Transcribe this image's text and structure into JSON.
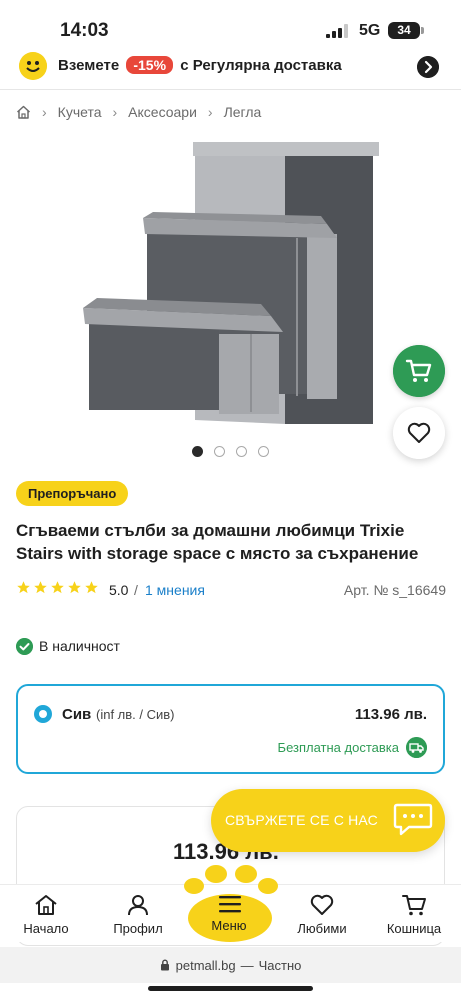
{
  "status": {
    "time": "14:03",
    "network": "5G",
    "battery": "34"
  },
  "promo": {
    "before": "Вземете",
    "badge": "-15%",
    "after": "с Регулярна доставка",
    "icon": "smiley-icon"
  },
  "breadcrumb": {
    "items": [
      "Кучета",
      "Аксесоари",
      "Легла"
    ]
  },
  "gallery": {
    "total": 4,
    "active": 1
  },
  "product": {
    "badge": "Препоръчано",
    "title": "Сгъваеми стълби за домашни любимци Trixie Stairs with storage space с място за съхранение",
    "rating": 5.0,
    "rating_text": "5.0",
    "rating_sep": "/",
    "reviews": "1 мнения",
    "sku": "Арт. № s_16649",
    "stock": "В наличност"
  },
  "variant": {
    "name": "Сив",
    "meta": "(inf лв. / Сив)",
    "price": "113.96 лв.",
    "shipping": "Безплатна доставка"
  },
  "price_card": {
    "price": "113.96 лв."
  },
  "contact": {
    "label": "СВЪРЖЕТЕ СЕ С НАС"
  },
  "nav": {
    "home": "Начало",
    "profile": "Профил",
    "menu": "Меню",
    "favorites": "Любими",
    "cart": "Кошница"
  },
  "browser": {
    "domain": "petmall.bg",
    "sep": "—",
    "mode": "Частно"
  },
  "colors": {
    "accent": "#f7d21a",
    "green": "#2e9b55",
    "blue": "#20a7d8",
    "link": "#1a7fc9"
  }
}
